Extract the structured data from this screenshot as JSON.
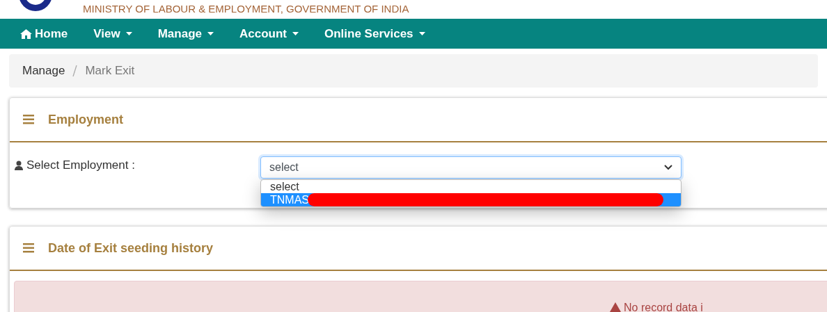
{
  "header": {
    "ministry": "MINISTRY OF LABOUR & EMPLOYMENT, GOVERNMENT OF INDIA"
  },
  "nav": [
    {
      "label": "Home",
      "kind": "home"
    },
    {
      "label": "View",
      "kind": "menu"
    },
    {
      "label": "Manage",
      "kind": "menu"
    },
    {
      "label": "Account",
      "kind": "menu"
    },
    {
      "label": "Online Services",
      "kind": "menu"
    }
  ],
  "breadcrumb": [
    "Manage",
    "Mark Exit"
  ],
  "employment": {
    "title": "Employment",
    "label": "Select Employment :",
    "select": {
      "value": "select",
      "options": [
        {
          "label": "select",
          "highlighted": false,
          "redacted": false
        },
        {
          "label": "TNMAS",
          "highlighted": true,
          "redacted": true
        }
      ]
    }
  },
  "history": {
    "title": "Date of Exit seeding history",
    "alert": "No record data i"
  }
}
